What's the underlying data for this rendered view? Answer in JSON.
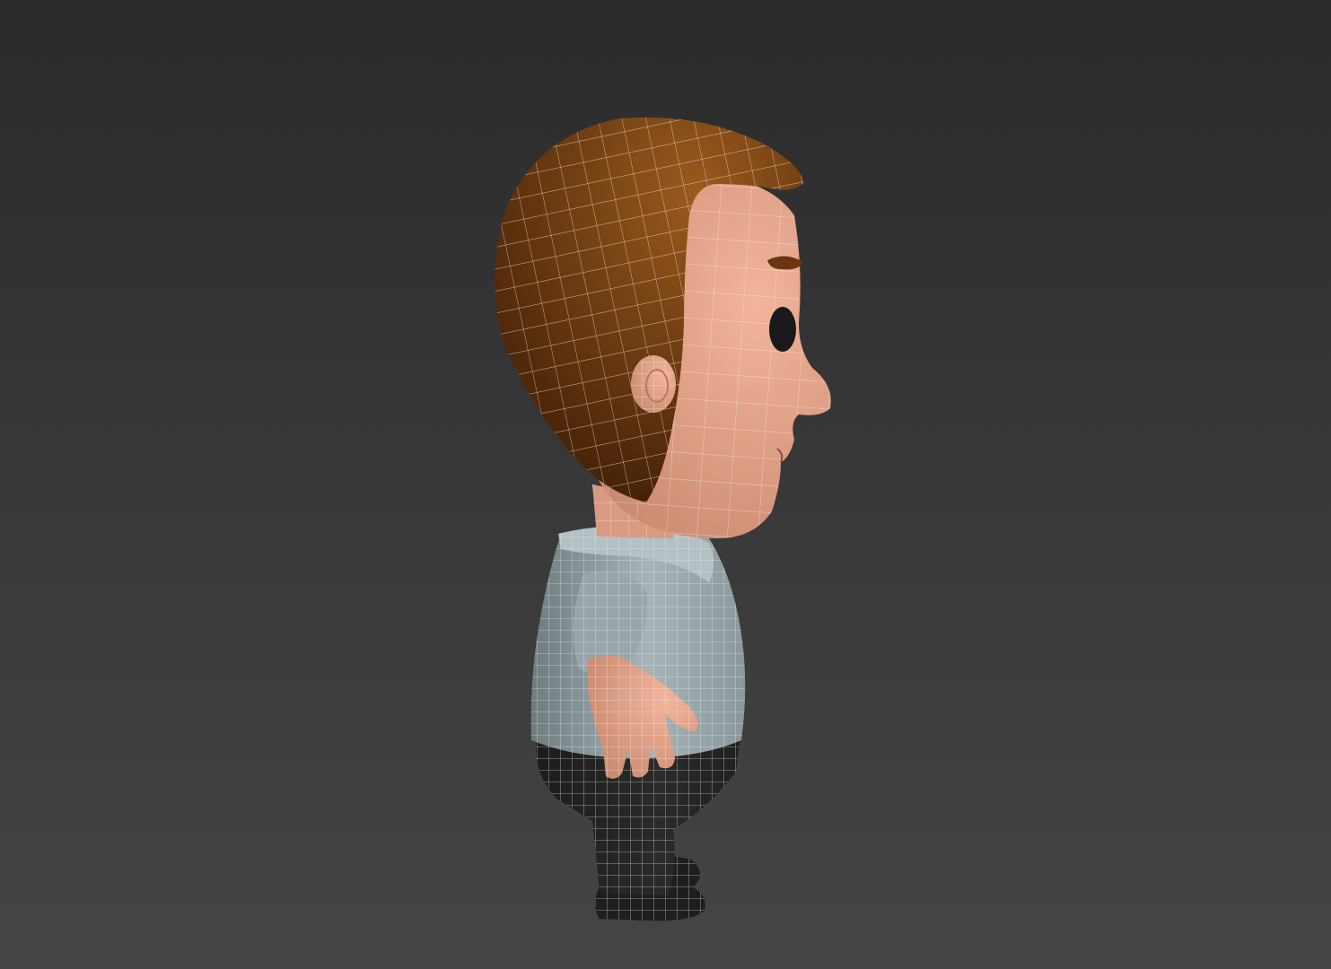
{
  "viewport": {
    "background_top": "#2b2b2b",
    "background_bottom": "#454545",
    "view": "side-profile"
  },
  "model": {
    "subject": "cartoon-boy-character",
    "display_mode": "shaded-with-wireframe",
    "wireframe_color": "#e8e8e8",
    "colors": {
      "hair_light": "#9a5a1c",
      "hair_dark": "#3e1c05",
      "skin": "#f2b49a",
      "skin_shadow": "#c98a70",
      "shirt": "#a6b4b8",
      "shirt_shadow": "#6e7c80",
      "pants": "#2a2a2a",
      "shoes": "#1e1e1e",
      "eye": "#1a1a1a",
      "eyebrow": "#6a3510"
    }
  }
}
